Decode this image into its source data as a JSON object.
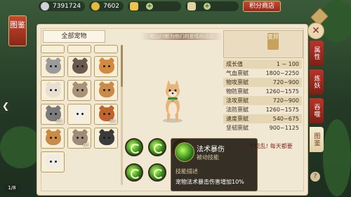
{
  "currency": {
    "silver": "7391724",
    "gold": "7602",
    "ingot": "",
    "shop_label": "积分商店"
  },
  "side_tag": "图鉴",
  "pet_list": {
    "all_label": "全部宠物",
    "cells": [
      {
        "level": "",
        "color": "#b27a45"
      },
      {
        "level": "",
        "color": "#c9c2b8"
      },
      {
        "level": "",
        "color": "#d9d2c6"
      },
      {
        "level": "",
        "color": "#9b9b9b"
      },
      {
        "level": "",
        "color": "#6a5a50"
      },
      {
        "level": "",
        "color": "#d38a3e"
      },
      {
        "level": "",
        "color": "#e6dfd2"
      },
      {
        "level": "",
        "color": "#a9927a"
      },
      {
        "level": "",
        "color": "#c98b47"
      },
      {
        "level": "65",
        "color": "#7b7b7b"
      },
      {
        "level": "",
        "color": "#f3efe6"
      },
      {
        "level": "65",
        "color": "#c1632f"
      },
      {
        "level": "",
        "color": "#c98b47"
      },
      {
        "level": "65",
        "color": "#a08a78"
      },
      {
        "level": "",
        "color": "#3b3b3b"
      },
      {
        "level": "",
        "color": "#f0ece4"
      }
    ]
  },
  "banner_text": "唱山川都为他们的爱情而动容",
  "stats_header": {
    "type_label": "变异"
  },
  "stats": [
    {
      "label": "成长值",
      "value": "1 ~ 100"
    },
    {
      "label": "气血禀赋",
      "value": "1800~2250"
    },
    {
      "label": "物攻禀赋",
      "value": "720~900"
    },
    {
      "label": "物防禀赋",
      "value": "1260~1575"
    },
    {
      "label": "法攻禀赋",
      "value": "720~900"
    },
    {
      "label": "法防禀赋",
      "value": "1260~1575"
    },
    {
      "label": "速度禀赋",
      "value": "540~675"
    },
    {
      "label": "坚韧禀赋",
      "value": "900~1125"
    }
  ],
  "extra_text": "不能乱! 每天都要",
  "tooltip": {
    "name": "法术暴伤",
    "type": "被动技能",
    "desc_label": "技能描述",
    "desc": "宠物法术暴击伤害增加10%"
  },
  "tabs": [
    "属性",
    "炼妖",
    "吞噬",
    "图鉴"
  ],
  "bottom_left_label": "1/8"
}
